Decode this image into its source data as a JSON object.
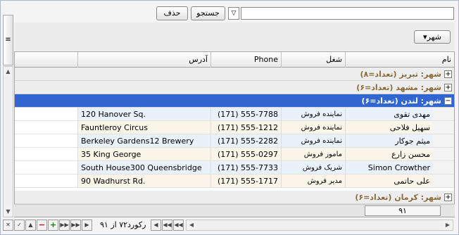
{
  "toolbar": {
    "delete_label": "حذف",
    "search_label": "جستجو",
    "field_dropdown_glyph": "▽",
    "search_value": ""
  },
  "group_panel": {
    "chip_label": "▾شهر"
  },
  "left_strip_glyph": "≡",
  "columns": {
    "name": "نام",
    "job": "شغل",
    "phone": "Phone",
    "address": "آدرس"
  },
  "groups": [
    {
      "label": "شهر: تبریز (تعداد=۸)",
      "expander": "+",
      "selected": false
    },
    {
      "label": "شهر: مشهد (تعداد=۶)",
      "expander": "+",
      "selected": false
    },
    {
      "label": "شهر: لندن (تعداد=۶)",
      "expander": "−",
      "selected": true
    },
    {
      "label": "شهر: کرمان (تعداد=۶)",
      "expander": "+",
      "selected": false
    }
  ],
  "rows": [
    {
      "name": "مهدی تقوی",
      "job": "نماینده فروش",
      "phone": "(171) 555-7788",
      "address": "120 Hanover Sq."
    },
    {
      "name": "سهیل فلاحی",
      "job": "نماینده فروش",
      "phone": "(171) 555-1212",
      "address": "Fauntleroy Circus"
    },
    {
      "name": "میثم جوکار",
      "job": "نماینده فروش",
      "phone": "(171) 555-2282",
      "address": "Berkeley Gardens12  Brewery"
    },
    {
      "name": "محسن زارع",
      "job": "مامور فروش",
      "phone": "(171) 555-0297",
      "address": "35 King George"
    },
    {
      "name": "Simon Crowther",
      "job": "شریک فروش",
      "phone": "(171) 555-7733",
      "address": "South House300 Queensbridge"
    },
    {
      "name": "علی حاتمی",
      "job": "مدیر فروش",
      "phone": "(171) 555-1717",
      "address": "90 Wadhurst Rd."
    }
  ],
  "footer_total": "۹۱",
  "navigator": {
    "record_text": "رکورد۷۲ از ۹۱",
    "buttons": [
      "◀◀",
      "◀◀",
      "◀",
      "▶",
      "▶▶",
      "▶▶",
      "+",
      "−",
      "▲",
      "✓",
      "✕"
    ]
  },
  "scroll": {
    "up": "▲",
    "down": "▼",
    "left": "◀",
    "right": "▶"
  }
}
